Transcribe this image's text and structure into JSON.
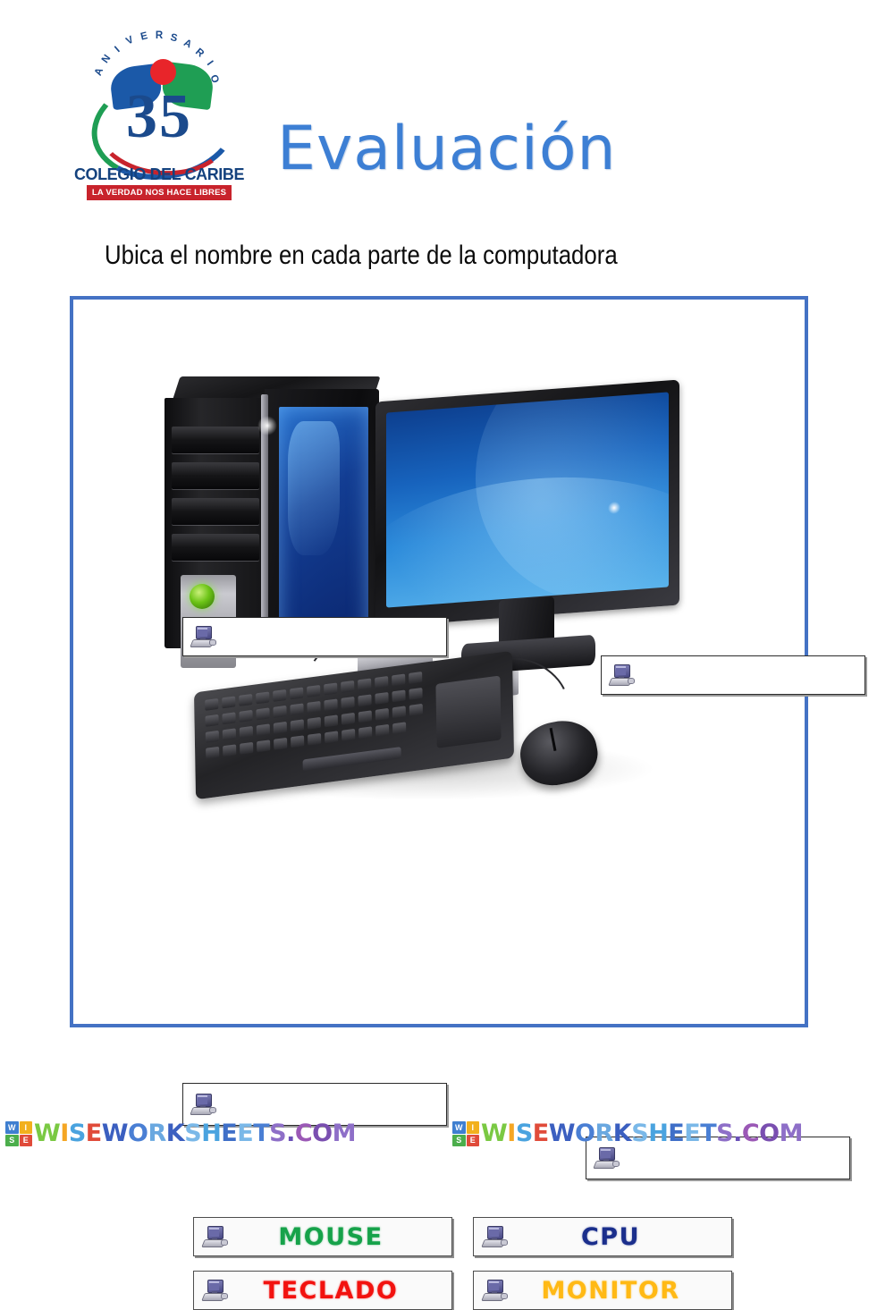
{
  "header": {
    "logo": {
      "anniversary_word": "ANIVERSARIO",
      "number": "35",
      "school_name": "COLEGIO DEL CARIBE",
      "motto": "LA VERDAD NOS HACE LIBRES"
    },
    "title": "Evaluación",
    "title_color": "#3d7fd4"
  },
  "instruction": "Ubica el nombre en cada parte de la computadora",
  "worksheet": {
    "frame_color": "#4472c4",
    "illustration_alt": "desktop-computer-tower-monitor-keyboard-mouse",
    "drop_targets": [
      {
        "id": "target-cpu",
        "icon": "computer-icon",
        "value": ""
      },
      {
        "id": "target-monitor",
        "icon": "computer-icon",
        "value": ""
      },
      {
        "id": "target-teclado",
        "icon": "computer-icon",
        "value": ""
      },
      {
        "id": "target-mouse",
        "icon": "computer-icon",
        "value": ""
      }
    ],
    "answer_chips": [
      {
        "id": "chip-mouse",
        "label": "MOUSE",
        "color": "#16a24a",
        "icon": "computer-icon"
      },
      {
        "id": "chip-cpu",
        "label": "CPU",
        "color": "#1a2e8c",
        "icon": "computer-icon"
      },
      {
        "id": "chip-teclado",
        "label": "TECLADO",
        "color": "#f2120f",
        "icon": "computer-icon"
      },
      {
        "id": "chip-monitor",
        "label": "MONITOR",
        "color": "#ffb915",
        "icon": "computer-icon"
      }
    ]
  },
  "footer": {
    "watermark_text": "WISEWORKSHEETS.COM",
    "logo_letters": [
      "W",
      "I",
      "S",
      "E"
    ]
  }
}
